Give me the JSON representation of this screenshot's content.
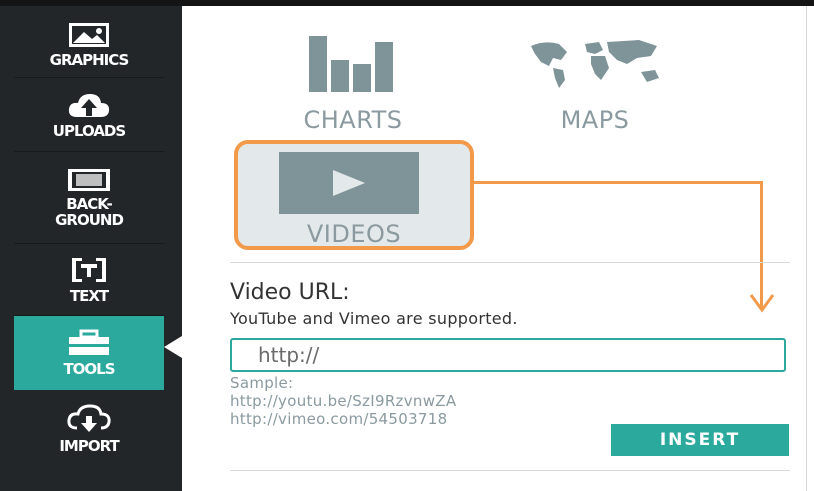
{
  "sidebar": {
    "items": [
      {
        "label": "GRAPHICS",
        "icon": "image-icon"
      },
      {
        "label": "UPLOADS",
        "icon": "cloud-upload-icon"
      },
      {
        "label": "BACK-\nGROUND",
        "icon": "background-icon"
      },
      {
        "label": "TEXT",
        "icon": "text-icon"
      },
      {
        "label": "TOOLS",
        "icon": "toolbox-icon"
      },
      {
        "label": "IMPORT",
        "icon": "cloud-download-icon"
      }
    ],
    "active": "TOOLS"
  },
  "tiles": {
    "charts": "CHARTS",
    "maps": "MAPS",
    "videos": "VIDEOS"
  },
  "video_form": {
    "title": "Video URL:",
    "subtitle": "YouTube and Vimeo are supported.",
    "placeholder": "http://",
    "value": "",
    "sample_label": "Sample:",
    "sample_1": "http://youtu.be/SzI9RzvnwZA",
    "sample_2": "http://vimeo.com/54503718",
    "insert_label": "INSERT"
  },
  "colors": {
    "sidebar_bg": "#232628",
    "accent_teal": "#2aa99c",
    "highlight_orange": "#f29a4a",
    "icon_gray": "#7e9499"
  }
}
